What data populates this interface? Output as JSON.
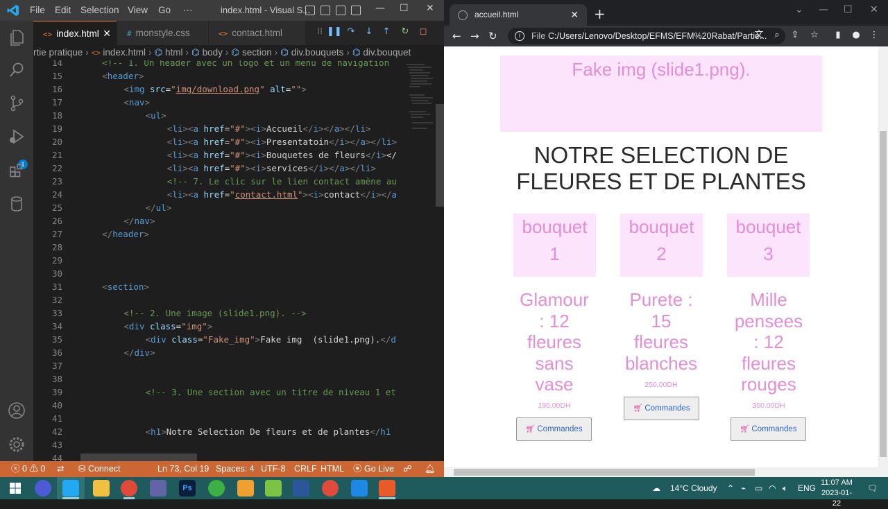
{
  "vscode": {
    "title": "index.html - Visual S...",
    "menu": [
      "File",
      "Edit",
      "Selection",
      "View",
      "Go",
      "···"
    ],
    "tabs": [
      {
        "label": "index.html",
        "icon": "<>",
        "active": true
      },
      {
        "label": "monstyle.css",
        "icon": "#",
        "active": false
      },
      {
        "label": "contact.html",
        "icon": "<>",
        "active": false
      }
    ],
    "breadcrumb": [
      "rtie pratique",
      "index.html",
      "html",
      "body",
      "section",
      "div.bouquets",
      "div.bouquet"
    ],
    "lines": [
      {
        "n": "14",
        "indent": 4,
        "text": "<!-- 1. Un header avec un logo et un menu de navigation"
      },
      {
        "n": "15",
        "indent": 4,
        "text": "<header>"
      },
      {
        "n": "16",
        "indent": 8,
        "text": "<img src=\"img/download.png\" alt=\"\">"
      },
      {
        "n": "17",
        "indent": 8,
        "text": "<nav>"
      },
      {
        "n": "18",
        "indent": 12,
        "text": "<ul>"
      },
      {
        "n": "19",
        "indent": 16,
        "text": "<li><a href=\"#\"><i>Accueil</i></a></li>"
      },
      {
        "n": "20",
        "indent": 16,
        "text": "<li><a href=\"#\"><i>Presentatoin</i></a></li>"
      },
      {
        "n": "21",
        "indent": 16,
        "text": "<li><a href=\"#\"><i>Bouquetes de fleurs</i></"
      },
      {
        "n": "22",
        "indent": 16,
        "text": "<li><a href=\"#\"><i>services</i></a></li>"
      },
      {
        "n": "23",
        "indent": 16,
        "text": "<!-- 7. Le clic sur le lien contact amène au"
      },
      {
        "n": "24",
        "indent": 16,
        "text": "<li><a href=\"contact.html\"><i>contact</i></a"
      },
      {
        "n": "25",
        "indent": 12,
        "text": "</ul>"
      },
      {
        "n": "26",
        "indent": 8,
        "text": "</nav>"
      },
      {
        "n": "27",
        "indent": 4,
        "text": "</header>"
      },
      {
        "n": "28",
        "indent": 0,
        "text": ""
      },
      {
        "n": "29",
        "indent": 0,
        "text": ""
      },
      {
        "n": "30",
        "indent": 0,
        "text": ""
      },
      {
        "n": "31",
        "indent": 4,
        "text": "<section>"
      },
      {
        "n": "32",
        "indent": 0,
        "text": ""
      },
      {
        "n": "33",
        "indent": 8,
        "text": "<!-- 2. Une image (slide1.png). -->"
      },
      {
        "n": "34",
        "indent": 8,
        "text": "<div class=\"img\">"
      },
      {
        "n": "35",
        "indent": 12,
        "text": "<div class=\"Fake_img\">Fake img  (slide1.png).</d"
      },
      {
        "n": "36",
        "indent": 8,
        "text": "</div>"
      },
      {
        "n": "37",
        "indent": 0,
        "text": ""
      },
      {
        "n": "38",
        "indent": 0,
        "text": ""
      },
      {
        "n": "39",
        "indent": 12,
        "text": "<!-- 3. Une section avec un titre de niveau 1 et"
      },
      {
        "n": "40",
        "indent": 0,
        "text": ""
      },
      {
        "n": "41",
        "indent": 0,
        "text": ""
      },
      {
        "n": "42",
        "indent": 12,
        "text": "<h1>Notre Selection De fleurs et de plantes</h1"
      },
      {
        "n": "43",
        "indent": 0,
        "text": ""
      },
      {
        "n": "44",
        "indent": 0,
        "text": ""
      }
    ],
    "status": {
      "errors": "0",
      "warnings": "0",
      "connect": "Connect",
      "position": "Ln 73, Col 19",
      "spaces": "Spaces: 4",
      "encoding": "UTF-8",
      "eol": "CRLF",
      "language": "HTML",
      "golive": "Go Live"
    },
    "debug_badge": "1"
  },
  "chrome": {
    "tab_title": "accueil.html",
    "omnibox_scheme": "File",
    "omnibox_url": "C:/Users/Lenovo/Desktop/EFMS/EFM%20Rabat/Partie...",
    "page": {
      "fake_img": "Fake img (slide1.png).",
      "title_line1": "NOTRE SELECTION DE",
      "title_line2": "FLEURES ET DE PLANTES",
      "bouquets": [
        {
          "img_line1": "bouquet",
          "img_line2": "1",
          "name_lines": [
            "Glamour",
            ": 12",
            "fleures",
            "sans",
            "vase"
          ],
          "price": "190.00DH",
          "button": "Commandes"
        },
        {
          "img_line1": "bouquet",
          "img_line2": "2",
          "name_lines": [
            "Purete :",
            "15",
            "fleures",
            "blanches"
          ],
          "price": "250.00DH",
          "button": "Commandes"
        },
        {
          "img_line1": "bouquet",
          "img_line2": "3",
          "name_lines": [
            "Mille",
            "pensees",
            ": 12",
            "fleures",
            "rouges"
          ],
          "price": "300.00DH",
          "button": "Commandes"
        }
      ]
    }
  },
  "taskbar": {
    "weather": "14°C  Cloudy",
    "lang": "ENG",
    "time": "11:07 AM",
    "date": "2023-01-22"
  },
  "colors": {
    "vscode_status": "#cc6633",
    "tab_accent": "#e37933",
    "pink_text": "#e48ed5",
    "pink_bg": "#fce4fc",
    "taskbar": "#1f5a5c"
  }
}
